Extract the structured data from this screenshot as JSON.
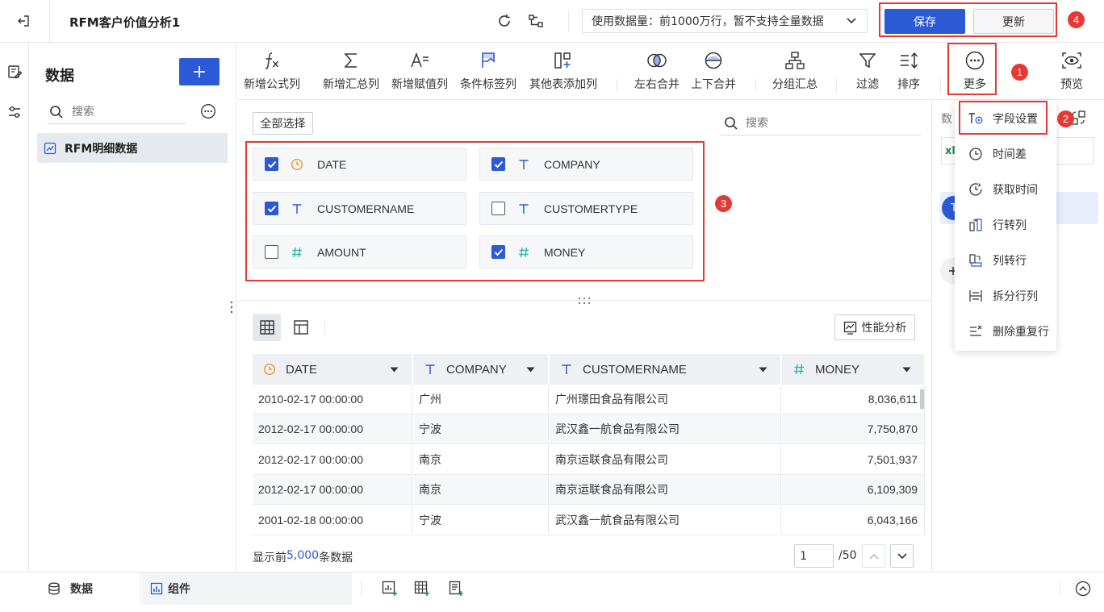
{
  "header": {
    "title": "RFM客户价值分析1",
    "data_amount_label": "使用数据量：前1000万行，暂不支持全量数据",
    "save_label": "保存",
    "update_label": "更新"
  },
  "sidebar": {
    "title": "数据",
    "search_placeholder": "搜索",
    "dataset_name": "RFM明细数据"
  },
  "toolbar": {
    "items": [
      {
        "label": "新增公式列",
        "icon": "formula-icon"
      },
      {
        "label": "新增汇总列",
        "icon": "sigma-icon"
      },
      {
        "label": "新增赋值列",
        "icon": "assign-icon"
      },
      {
        "label": "条件标签列",
        "icon": "flag-icon"
      },
      {
        "label": "其他表添加列",
        "icon": "add-column-icon"
      },
      {
        "label": "左右合并",
        "icon": "merge-lr-icon"
      },
      {
        "label": "上下合并",
        "icon": "merge-ud-icon"
      },
      {
        "label": "分组汇总",
        "icon": "group-icon"
      },
      {
        "label": "过滤",
        "icon": "filter-icon"
      },
      {
        "label": "排序",
        "icon": "sort-icon"
      },
      {
        "label": "更多",
        "icon": "more-icon"
      },
      {
        "label": "预览",
        "icon": "preview-icon"
      }
    ]
  },
  "fields": {
    "select_all_label": "全部选择",
    "search_placeholder": "搜索",
    "items": [
      {
        "name": "DATE",
        "type": "date",
        "checked": true
      },
      {
        "name": "COMPANY",
        "type": "text",
        "checked": true
      },
      {
        "name": "CUSTOMERNAME",
        "type": "text",
        "checked": true
      },
      {
        "name": "CUSTOMERTYPE",
        "type": "text",
        "checked": false
      },
      {
        "name": "AMOUNT",
        "type": "number",
        "checked": false
      },
      {
        "name": "MONEY",
        "type": "number",
        "checked": true
      }
    ]
  },
  "table": {
    "perf_label": "性能分析",
    "columns": [
      {
        "name": "DATE",
        "type": "date"
      },
      {
        "name": "COMPANY",
        "type": "text"
      },
      {
        "name": "CUSTOMERNAME",
        "type": "text"
      },
      {
        "name": "MONEY",
        "type": "number"
      }
    ],
    "rows": [
      [
        "2010-02-17 00:00:00",
        "广州",
        "广州璟田食品有限公司",
        "8,036,611"
      ],
      [
        "2012-02-17 00:00:00",
        "宁波",
        "武汉鑫一航食品有限公司",
        "7,750,870"
      ],
      [
        "2012-02-17 00:00:00",
        "南京",
        "南京运联食品有限公司",
        "7,501,937"
      ],
      [
        "2012-02-17 00:00:00",
        "南京",
        "南京运联食品有限公司",
        "6,109,309"
      ],
      [
        "2001-02-18 00:00:00",
        "宁波",
        "武汉鑫一航食品有限公司",
        "6,043,166"
      ]
    ],
    "footer_prefix": "显示前",
    "footer_count": "5,000",
    "footer_suffix": "条数据",
    "page_value": "1",
    "page_total": "/50"
  },
  "right_panel": {
    "title_partial": "数",
    "xl_partial": "xl"
  },
  "more_menu": {
    "items": [
      {
        "label": "字段设置",
        "icon": "field-settings-icon"
      },
      {
        "label": "时间差",
        "icon": "time-diff-icon"
      },
      {
        "label": "获取时间",
        "icon": "get-time-icon"
      },
      {
        "label": "行转列",
        "icon": "row-to-col-icon"
      },
      {
        "label": "列转行",
        "icon": "col-to-row-icon"
      },
      {
        "label": "拆分行列",
        "icon": "split-icon"
      },
      {
        "label": "删除重复行",
        "icon": "dedupe-icon"
      }
    ]
  },
  "badges": [
    "1",
    "2",
    "3",
    "4"
  ],
  "bottom": {
    "tab_data": "数据",
    "tab_component": "组件"
  },
  "colors": {
    "accent": "#2c5ad6",
    "annotation": "#e53935",
    "date_icon": "#e8952c",
    "text_icon": "#2c5ad6",
    "number_icon": "#3bb5a7"
  }
}
